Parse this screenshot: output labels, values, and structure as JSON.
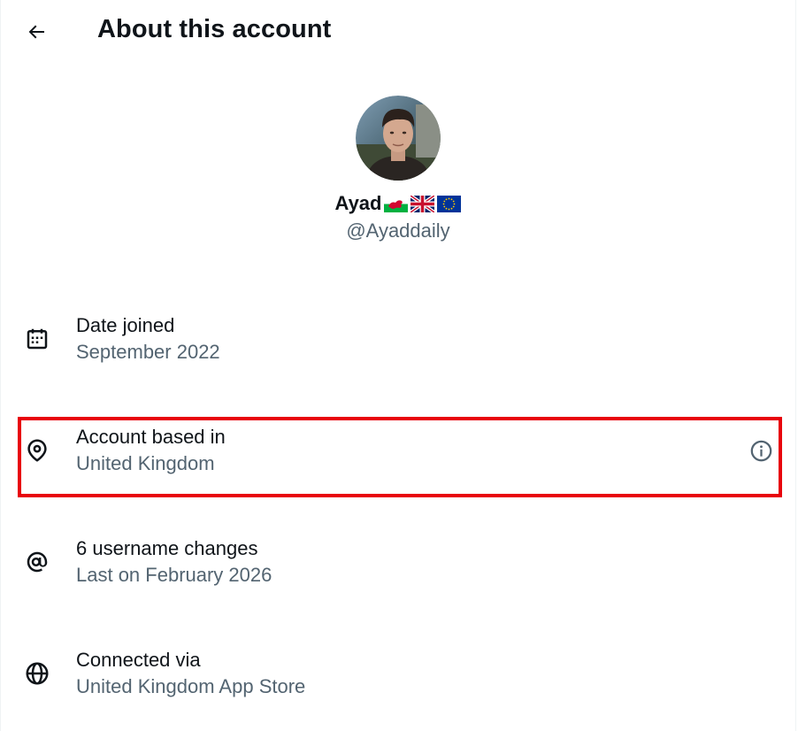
{
  "header": {
    "title": "About this account",
    "back_icon": "arrow-left-icon"
  },
  "profile": {
    "display_name": "Ayad",
    "flags": [
      "wales-flag-icon",
      "uk-flag-icon",
      "eu-flag-icon"
    ],
    "handle": "@Ayaddaily"
  },
  "rows": [
    {
      "icon": "calendar-icon",
      "label": "Date joined",
      "value": "September 2022"
    },
    {
      "icon": "location-pin-icon",
      "label": "Account based in",
      "value": "United Kingdom",
      "info_icon": "info-icon"
    },
    {
      "icon": "at-sign-icon",
      "label": "6 username changes",
      "value": "Last on February 2026"
    },
    {
      "icon": "globe-icon",
      "label": "Connected via",
      "value": "United Kingdom App Store"
    }
  ],
  "colors": {
    "text_primary": "#0f1419",
    "text_secondary": "#536471",
    "highlight_border": "#e8000b"
  }
}
